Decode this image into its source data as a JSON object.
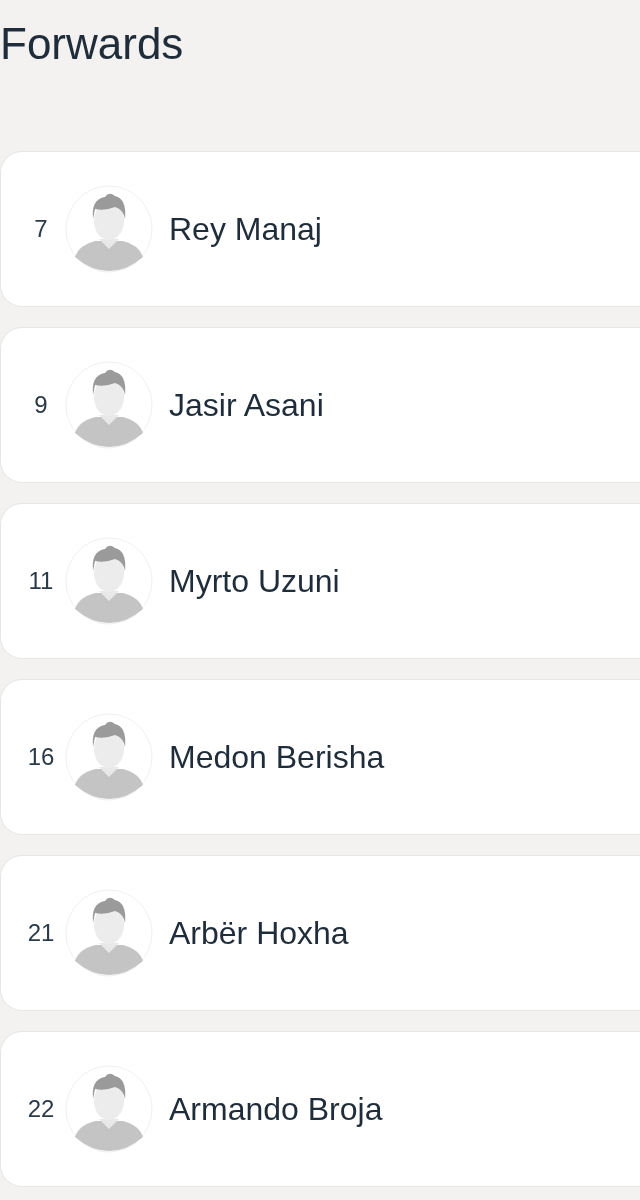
{
  "section": {
    "title": "Forwards"
  },
  "players": [
    {
      "number": "7",
      "name": "Rey Manaj"
    },
    {
      "number": "9",
      "name": "Jasir Asani"
    },
    {
      "number": "11",
      "name": "Myrto Uzuni"
    },
    {
      "number": "16",
      "name": "Medon Berisha"
    },
    {
      "number": "21",
      "name": "Arbër Hoxha"
    },
    {
      "number": "22",
      "name": "Armando Broja"
    }
  ]
}
